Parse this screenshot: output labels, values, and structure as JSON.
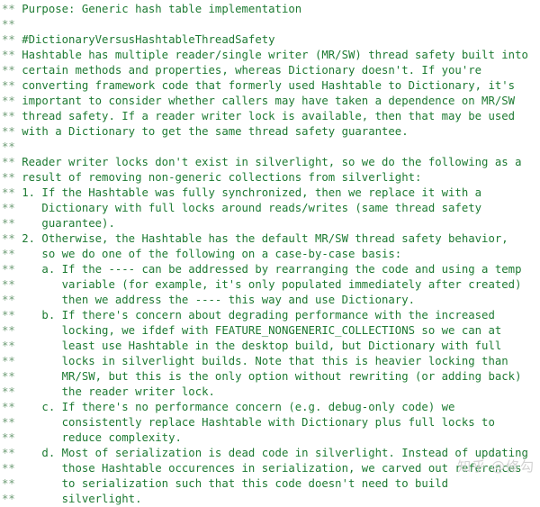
{
  "editor": {
    "language": "csharp-comment-block",
    "colors": {
      "background": "#ffffff",
      "comment_marker": "#6d9c75",
      "comment_text": "#1d7a32",
      "watermark": "#d2d2d2"
    }
  },
  "watermark": {
    "text": "知乎 @修勾"
  },
  "lines": [
    {
      "marker": "**",
      "text": " Purpose: Generic hash table implementation"
    },
    {
      "marker": "**",
      "text": ""
    },
    {
      "marker": "**",
      "text": " #DictionaryVersusHashtableThreadSafety"
    },
    {
      "marker": "**",
      "text": " Hashtable has multiple reader/single writer (MR/SW) thread safety built into"
    },
    {
      "marker": "**",
      "text": " certain methods and properties, whereas Dictionary doesn't. If you're"
    },
    {
      "marker": "**",
      "text": " converting framework code that formerly used Hashtable to Dictionary, it's"
    },
    {
      "marker": "**",
      "text": " important to consider whether callers may have taken a dependence on MR/SW"
    },
    {
      "marker": "**",
      "text": " thread safety. If a reader writer lock is available, then that may be used"
    },
    {
      "marker": "**",
      "text": " with a Dictionary to get the same thread safety guarantee."
    },
    {
      "marker": "**",
      "text": ""
    },
    {
      "marker": "**",
      "text": " Reader writer locks don't exist in silverlight, so we do the following as a"
    },
    {
      "marker": "**",
      "text": " result of removing non-generic collections from silverlight:"
    },
    {
      "marker": "**",
      "text": " 1. If the Hashtable was fully synchronized, then we replace it with a"
    },
    {
      "marker": "**",
      "text": "    Dictionary with full locks around reads/writes (same thread safety"
    },
    {
      "marker": "**",
      "text": "    guarantee)."
    },
    {
      "marker": "**",
      "text": " 2. Otherwise, the Hashtable has the default MR/SW thread safety behavior,"
    },
    {
      "marker": "**",
      "text": "    so we do one of the following on a case-by-case basis:"
    },
    {
      "marker": "**",
      "text": "    a. If the ---- can be addressed by rearranging the code and using a temp"
    },
    {
      "marker": "**",
      "text": "       variable (for example, it's only populated immediately after created)"
    },
    {
      "marker": "**",
      "text": "       then we address the ---- this way and use Dictionary."
    },
    {
      "marker": "**",
      "text": "    b. If there's concern about degrading performance with the increased"
    },
    {
      "marker": "**",
      "text": "       locking, we ifdef with FEATURE_NONGENERIC_COLLECTIONS so we can at"
    },
    {
      "marker": "**",
      "text": "       least use Hashtable in the desktop build, but Dictionary with full"
    },
    {
      "marker": "**",
      "text": "       locks in silverlight builds. Note that this is heavier locking than"
    },
    {
      "marker": "**",
      "text": "       MR/SW, but this is the only option without rewriting (or adding back)"
    },
    {
      "marker": "**",
      "text": "       the reader writer lock."
    },
    {
      "marker": "**",
      "text": "    c. If there's no performance concern (e.g. debug-only code) we"
    },
    {
      "marker": "**",
      "text": "       consistently replace Hashtable with Dictionary plus full locks to"
    },
    {
      "marker": "**",
      "text": "       reduce complexity."
    },
    {
      "marker": "**",
      "text": "    d. Most of serialization is dead code in silverlight. Instead of updating"
    },
    {
      "marker": "**",
      "text": "       those Hashtable occurences in serialization, we carved out references"
    },
    {
      "marker": "**",
      "text": "       to serialization such that this code doesn't need to build"
    },
    {
      "marker": "**",
      "text": "       silverlight."
    }
  ]
}
